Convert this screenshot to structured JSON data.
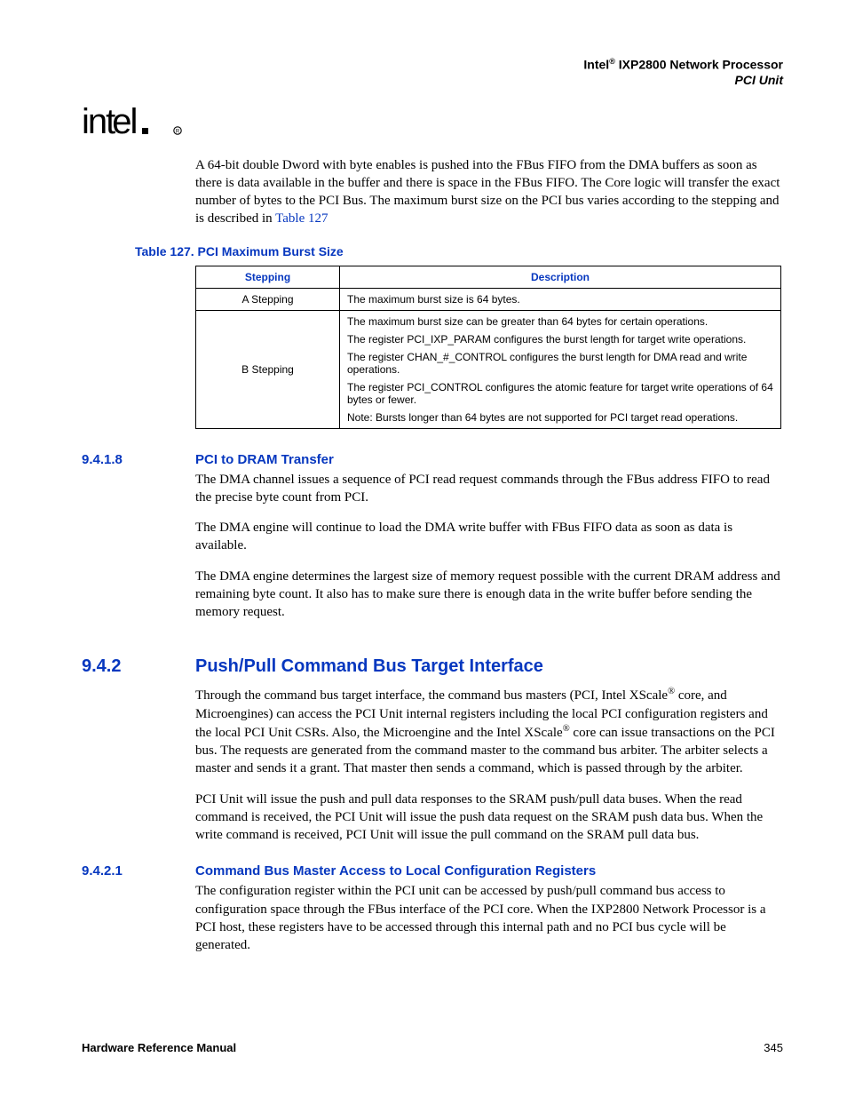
{
  "header": {
    "product_prefix": "Intel",
    "reg_mark": "®",
    "product_suffix": " IXP2800 Network Processor",
    "unit": "PCI Unit"
  },
  "intro_paragraph": {
    "pre": "A 64-bit double Dword with byte enables is pushed into the FBus FIFO from the DMA buffers as soon as there is data available in the buffer and there is space in the FBus FIFO. The Core logic will transfer the exact number of bytes to the PCI Bus. The maximum burst size on the PCI bus varies according to the stepping and is described in ",
    "ref": "Table 127"
  },
  "table127": {
    "caption": "Table 127. PCI Maximum Burst Size",
    "headers": {
      "c1": "Stepping",
      "c2": "Description"
    },
    "rows": [
      {
        "stepping": "A Stepping",
        "desc": [
          "The maximum burst size is 64 bytes."
        ]
      },
      {
        "stepping": "B Stepping",
        "desc": [
          "The maximum burst size can be greater than 64 bytes for certain operations.",
          "The register PCI_IXP_PARAM configures the burst length for target write operations.",
          "The register CHAN_#_CONTROL configures the burst length for DMA read and write operations.",
          "The register PCI_CONTROL configures the atomic feature for target write operations of 64 bytes or fewer.",
          "Note: Bursts longer than 64 bytes are not supported for PCI target read operations."
        ]
      }
    ]
  },
  "s9418": {
    "num": "9.4.1.8",
    "title": "PCI to DRAM Transfer",
    "p1": "The DMA channel issues a sequence of PCI read request commands through the FBus address FIFO to read the precise byte count from PCI.",
    "p2": "The DMA engine will continue to load the DMA write buffer with FBus FIFO data as soon as data is available.",
    "p3": "The DMA engine determines the largest size of memory request possible with the current DRAM address and remaining byte count. It also has to make sure there is enough data in the write buffer before sending the memory request."
  },
  "s942": {
    "num": "9.4.2",
    "title": "Push/Pull Command Bus Target Interface",
    "p1a": "Through the command bus target interface, the command bus masters (PCI, Intel XScale",
    "reg": "®",
    "p1b": " core, and Microengines) can access the PCI Unit internal registers including the local PCI configuration registers and the local PCI Unit CSRs. Also, the Microengine and the Intel XScale",
    "p1c": " core can issue transactions on the PCI bus. The requests are generated from the command master to the command bus arbiter. The arbiter selects a master and sends it a grant. That master then sends a command, which is passed through by the arbiter.",
    "p2": "PCI Unit will issue the push and pull data responses to the SRAM push/pull data buses. When the read command is received, the PCI Unit will issue the push data request on the SRAM push data bus. When the write command is received, PCI Unit will issue the pull command on the SRAM pull data bus."
  },
  "s9421": {
    "num": "9.4.2.1",
    "title": "Command Bus Master Access to Local Configuration Registers",
    "p1": "The configuration register within the PCI unit can be accessed by push/pull command bus access to configuration space through the FBus interface of the PCI core. When the IXP2800 Network Processor is a PCI host, these registers have to be accessed through this internal path and no PCI bus cycle will be generated."
  },
  "footer": {
    "left": "Hardware Reference Manual",
    "right": "345"
  }
}
